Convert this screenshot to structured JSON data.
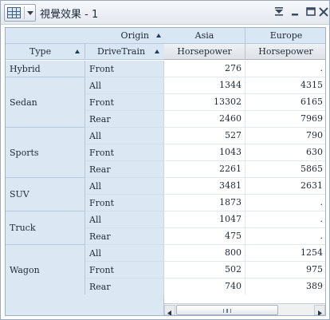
{
  "window": {
    "title": "視覺效果 - 1"
  },
  "header": {
    "origin_label": "Origin",
    "type_label": "Type",
    "drivetrain_label": "DriveTrain",
    "columns": [
      "Asia",
      "Europe"
    ],
    "measure": "Horsepower"
  },
  "rows": [
    {
      "type": "Hybrid",
      "drivetrains": [
        "Front"
      ],
      "asia": [
        "276"
      ],
      "europe": [
        "."
      ]
    },
    {
      "type": "Sedan",
      "drivetrains": [
        "All",
        "Front",
        "Rear"
      ],
      "asia": [
        "1344",
        "13302",
        "2460"
      ],
      "europe": [
        "4315",
        "6165",
        "7969"
      ]
    },
    {
      "type": "Sports",
      "drivetrains": [
        "All",
        "Front",
        "Rear"
      ],
      "asia": [
        "527",
        "1043",
        "2261"
      ],
      "europe": [
        "790",
        "630",
        "5865"
      ]
    },
    {
      "type": "SUV",
      "drivetrains": [
        "All",
        "Front"
      ],
      "asia": [
        "3481",
        "1873"
      ],
      "europe": [
        "2631",
        "."
      ]
    },
    {
      "type": "Truck",
      "drivetrains": [
        "All",
        "Rear"
      ],
      "asia": [
        "1047",
        "475"
      ],
      "europe": [
        ".",
        "."
      ]
    },
    {
      "type": "Wagon",
      "drivetrains": [
        "All",
        "Front",
        "Rear"
      ],
      "asia": [
        "800",
        "502",
        "740"
      ],
      "europe": [
        "1254",
        "975",
        "389"
      ]
    }
  ],
  "colors": {
    "header_bg": "#cfe0f1",
    "border": "#9fb2c9",
    "sort_icon": "#203a63"
  },
  "icons": [
    "table-menu-icon",
    "filter-icon",
    "minimize-icon",
    "maximize-icon",
    "close-icon",
    "sort-ascending-icon"
  ]
}
